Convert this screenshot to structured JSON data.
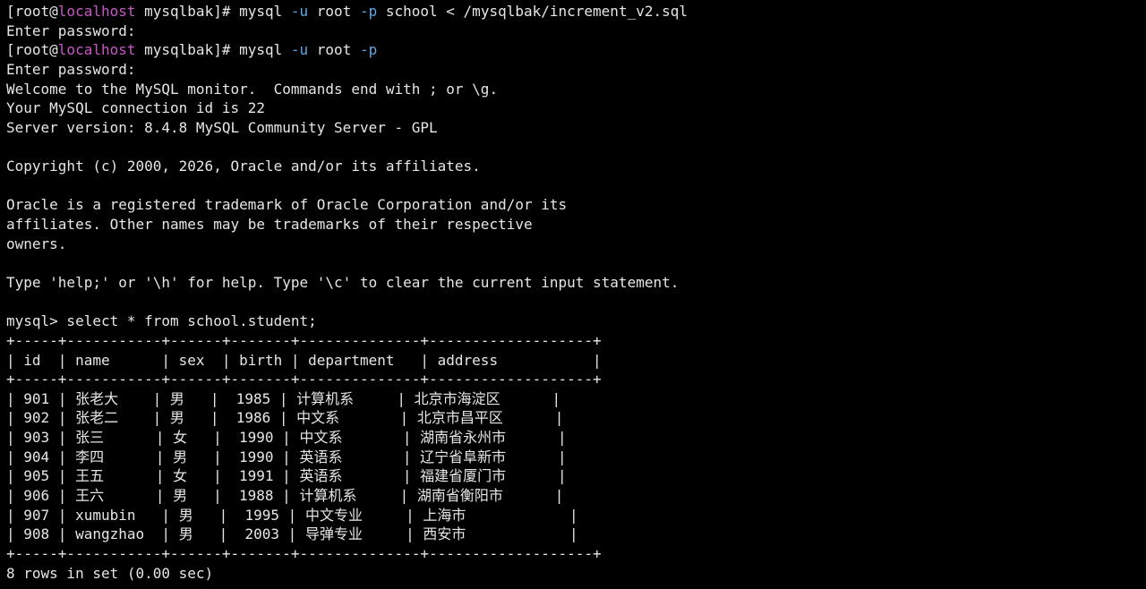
{
  "prompt": {
    "user_root": "[root@",
    "host": "localhost",
    "dir": " mysqlbak]# "
  },
  "lines": {
    "cmd1_a": "mysql ",
    "cmd1_u": "-u",
    "cmd1_b": " root ",
    "cmd1_p": "-p",
    "cmd1_c": " school < /mysqlbak/increment_v2.sql",
    "enter_pwd_1": "Enter password:",
    "cmd2_a": "mysql ",
    "cmd2_u": "-u",
    "cmd2_b": " root ",
    "cmd2_p": "-p",
    "enter_pwd_2": "Enter password:",
    "welcome": "Welcome to the MySQL monitor.  Commands end with ; or \\g.",
    "conn_id": "Your MySQL connection id is 22",
    "server_version": "Server version: 8.4.8 MySQL Community Server - GPL",
    "copyright": "Copyright (c) 2000, 2026, Oracle and/or its affiliates.",
    "oracle1": "Oracle is a registered trademark of Oracle Corporation and/or its",
    "oracle2": "affiliates. Other names may be trademarks of their respective",
    "oracle3": "owners.",
    "help": "Type 'help;' or '\\h' for help. Type '\\c' to clear the current input statement.",
    "query": "mysql> select * from school.student;",
    "border": "+-----+-----------+------+-------+--------------+-------------------+",
    "header": "| id  | name      | sex  | birth | department   | address           |",
    "result_summary": "8 rows in set (0.00 sec)"
  },
  "table": {
    "columns": [
      "id",
      "name",
      "sex",
      "birth",
      "department",
      "address"
    ],
    "rows": [
      {
        "id": "901",
        "name": "张老大",
        "sex": "男",
        "birth": "1985",
        "department": "计算机系",
        "address": "北京市海淀区"
      },
      {
        "id": "902",
        "name": "张老二",
        "sex": "男",
        "birth": "1986",
        "department": "中文系",
        "address": "北京市昌平区"
      },
      {
        "id": "903",
        "name": "张三",
        "sex": "女",
        "birth": "1990",
        "department": "中文系",
        "address": "湖南省永州市"
      },
      {
        "id": "904",
        "name": "李四",
        "sex": "男",
        "birth": "1990",
        "department": "英语系",
        "address": "辽宁省阜新市"
      },
      {
        "id": "905",
        "name": "王五",
        "sex": "女",
        "birth": "1991",
        "department": "英语系",
        "address": "福建省厦门市"
      },
      {
        "id": "906",
        "name": "王六",
        "sex": "男",
        "birth": "1988",
        "department": "计算机系",
        "address": "湖南省衡阳市"
      },
      {
        "id": "907",
        "name": "xumubin",
        "sex": "男",
        "birth": "1995",
        "department": "中文专业",
        "address": "上海市"
      },
      {
        "id": "908",
        "name": "wangzhao",
        "sex": "男",
        "birth": "2003",
        "department": "导弹专业",
        "address": "西安市"
      }
    ]
  },
  "colors": {
    "background": "#000000",
    "text": "#e6e6e6",
    "host": "#c858c8",
    "flag": "#5aa9e6"
  }
}
